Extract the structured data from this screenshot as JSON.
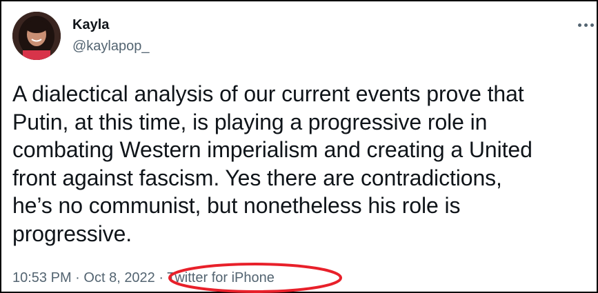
{
  "tweet": {
    "author": {
      "display_name": "Kayla",
      "handle": "@kaylapop_",
      "avatar_icon": "profile-photo"
    },
    "text_lines": [
      "A dialectical analysis of our current events prove that",
      "Putin, at this time, is playing a progressive role in",
      "combating Western imperialism and creating a United",
      "front against fascism. Yes there are contradictions,",
      "he’s no communist, but nonetheless his role is",
      "progressive."
    ],
    "time": "10:53 PM",
    "separator": "·",
    "date": "Oct 8, 2022",
    "source": "Twitter for iPhone",
    "more_icon": "more-horizontal-icon"
  },
  "annotation": {
    "color": "#e8202a",
    "shape": "ellipse"
  }
}
